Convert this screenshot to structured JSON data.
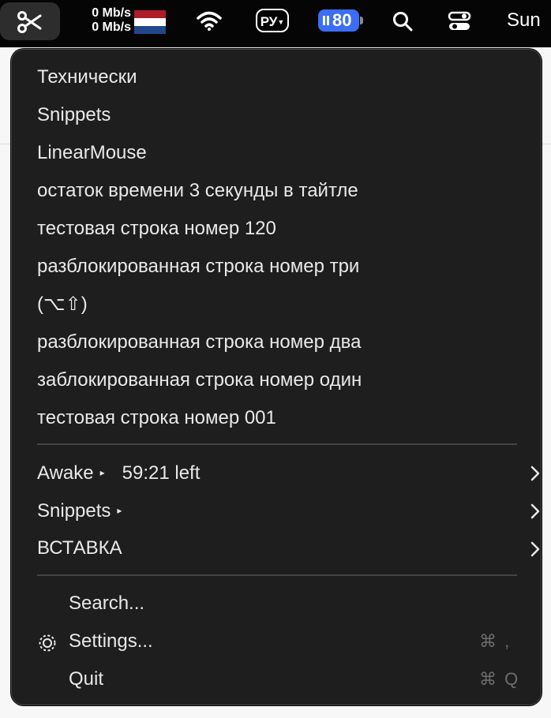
{
  "menubar": {
    "net_up": "0 Mb/s",
    "net_down": "0 Mb/s",
    "language": "РУ",
    "battery_percent": "80",
    "clock": "Sun",
    "icons": [
      "scissors-icon",
      "flag-nl-icon",
      "wifi-icon",
      "search-icon",
      "control-center-icon"
    ],
    "colors": {
      "battery": "#3b6ef5",
      "flag_red": "#ae1c28",
      "flag_white": "#ffffff",
      "flag_blue": "#21468b"
    }
  },
  "menu": {
    "history": [
      "Технически",
      "Snippets",
      "LinearMouse",
      "остаток времени 3 секунды в тайтле",
      "тестовая строка номер 120",
      "разблокированная строка номер три",
      "(⌥⇧)",
      "разблокированная строка номер два",
      "заблокированная строка номер один",
      "тестовая строка номер 001"
    ],
    "awake": {
      "label": "Awake",
      "marker": "▸",
      "time_left": "59:21 left"
    },
    "snippets": {
      "label": "Snippets",
      "marker": "▸"
    },
    "paste": {
      "label": "ВСТАВКА"
    },
    "search_label": "Search...",
    "settings_label": "Settings...",
    "settings_shortcut": "⌘ ,",
    "quit_label": "Quit",
    "quit_shortcut": "⌘ Q"
  }
}
